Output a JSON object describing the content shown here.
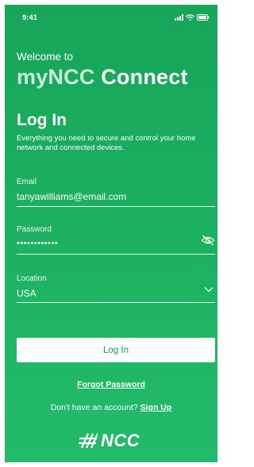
{
  "status_bar": {
    "time": "9:41",
    "icons": [
      "signal-icon",
      "wifi-icon",
      "battery-icon"
    ]
  },
  "header": {
    "welcome": "Welcome to",
    "app_name_part1": "myNCC",
    "app_name_part2": "Connect"
  },
  "login": {
    "heading": "Log In",
    "description": "Everything you need to secure and control your home network and connected devices."
  },
  "fields": {
    "email": {
      "label": "Email",
      "value": "tanyawilliams@email.com"
    },
    "password": {
      "label": "Password",
      "value": "••••••••••••",
      "toggle_icon": "eye-slash-icon"
    },
    "location": {
      "label": "Location",
      "value": "USA",
      "dropdown_icon": "chevron-down-icon"
    }
  },
  "actions": {
    "login_button": "Log In",
    "forgot_password": "Forgot Password",
    "no_account_text": "Don't have an account?",
    "signup_link": "Sign Up"
  },
  "brand": {
    "logo_text": "NCC",
    "logo_icon": "ncc-hatch-logo-icon"
  },
  "colors": {
    "background": "#1db261",
    "button_bg": "#ffffff",
    "button_text": "#16a358"
  }
}
